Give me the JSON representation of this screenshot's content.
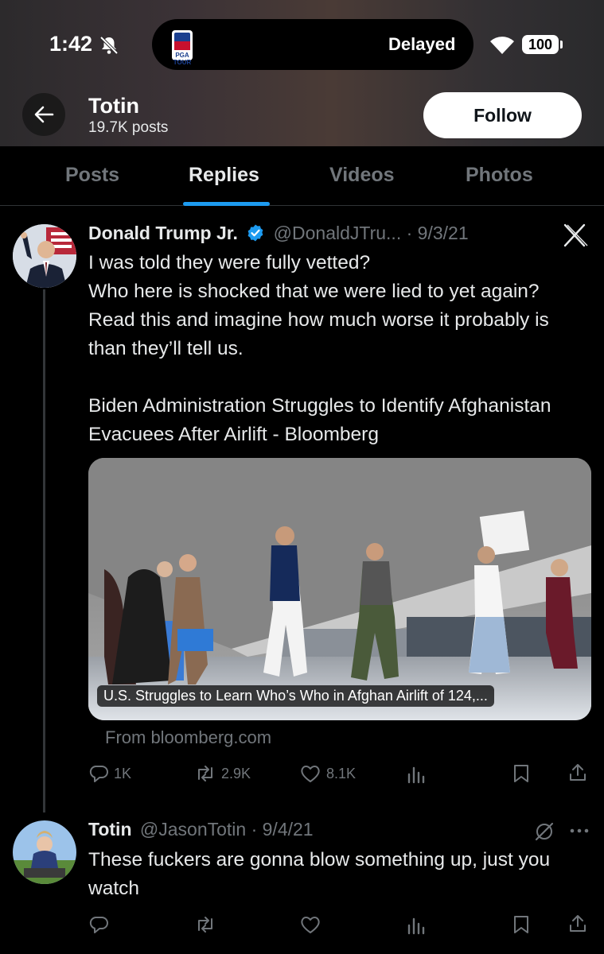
{
  "status_bar": {
    "time": "1:42",
    "carrier_label": "Delayed",
    "battery": "100",
    "app_badge": "PGA TOUR"
  },
  "header": {
    "name": "Totin",
    "posts": "19.7K posts",
    "follow_label": "Follow"
  },
  "tabs": [
    {
      "label": "Posts",
      "active": false
    },
    {
      "label": "Replies",
      "active": true
    },
    {
      "label": "Videos",
      "active": false
    },
    {
      "label": "Photos",
      "active": false
    }
  ],
  "tweet1": {
    "name": "Donald Trump Jr.",
    "handle": "@DonaldJTru...",
    "date": "· 9/3/21",
    "text": "I was told they were fully vetted?\nWho here is shocked that we were lied to yet again? Read this and imagine how much worse it probably is than they’ll tell us.\n\nBiden Administration Struggles to Identify Afghanistan Evacuees After Airlift - Bloomberg",
    "card_caption": "U.S. Struggles to Learn Who’s Who in Afghan Airlift of 124,...",
    "source": "From bloomberg.com",
    "replies": "1K",
    "reposts": "2.9K",
    "likes": "8.1K"
  },
  "tweet2": {
    "name": "Totin",
    "handle": "@JasonTotin",
    "date": "· 9/4/21",
    "text": "These fuckers are gonna blow something up, just you watch"
  },
  "colors": {
    "accent": "#1d9bf0",
    "muted": "#71767b",
    "text": "#e7e9ea",
    "verified": "#1d9bf0"
  }
}
